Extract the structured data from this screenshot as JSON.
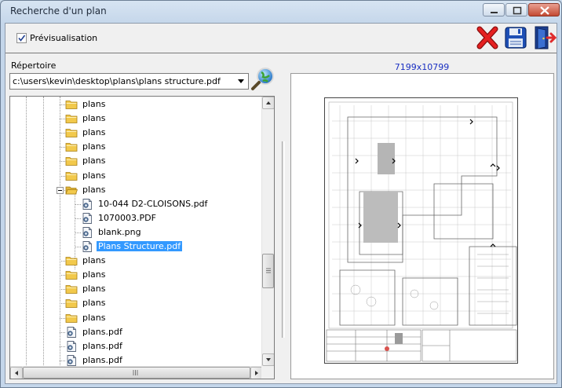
{
  "window": {
    "title": "Recherche d'un plan"
  },
  "toolbar": {
    "preview_label": "Prévisualisation",
    "preview_checked": true,
    "delete_icon": "red-x-icon",
    "save_icon": "floppy-disk-icon",
    "exit_icon": "exit-door-icon"
  },
  "directory": {
    "label": "Répertoire",
    "value": "c:\\users\\kevin\\desktop\\plans\\plans structure.pdf",
    "search_icon": "globe-magnifier-icon"
  },
  "tree": {
    "items": [
      {
        "label": "plans",
        "type": "folder"
      },
      {
        "label": "plans",
        "type": "folder"
      },
      {
        "label": "plans",
        "type": "folder"
      },
      {
        "label": "plans",
        "type": "folder"
      },
      {
        "label": "plans",
        "type": "folder"
      },
      {
        "label": "plans",
        "type": "folder"
      },
      {
        "label": "plans",
        "type": "folder-open"
      },
      {
        "label": "10-044 D2-CLOISONS.pdf",
        "type": "file"
      },
      {
        "label": "1070003.PDF",
        "type": "file"
      },
      {
        "label": "blank.png",
        "type": "file"
      },
      {
        "label": "Plans Structure.pdf",
        "type": "file",
        "selected": true
      },
      {
        "label": "plans",
        "type": "folder"
      },
      {
        "label": "plans",
        "type": "folder"
      },
      {
        "label": "plans",
        "type": "folder"
      },
      {
        "label": "plans",
        "type": "folder"
      },
      {
        "label": "plans",
        "type": "folder"
      },
      {
        "label": "plans.pdf",
        "type": "file"
      },
      {
        "label": "plans.pdf",
        "type": "file"
      },
      {
        "label": "plans.pdf",
        "type": "file"
      }
    ],
    "scroll_position": 0.58
  },
  "preview": {
    "dimensions": "7199x10799"
  },
  "colors": {
    "selection": "#3399ff",
    "dimension_text": "#1a2fc2",
    "folder": "#f2c94c"
  }
}
